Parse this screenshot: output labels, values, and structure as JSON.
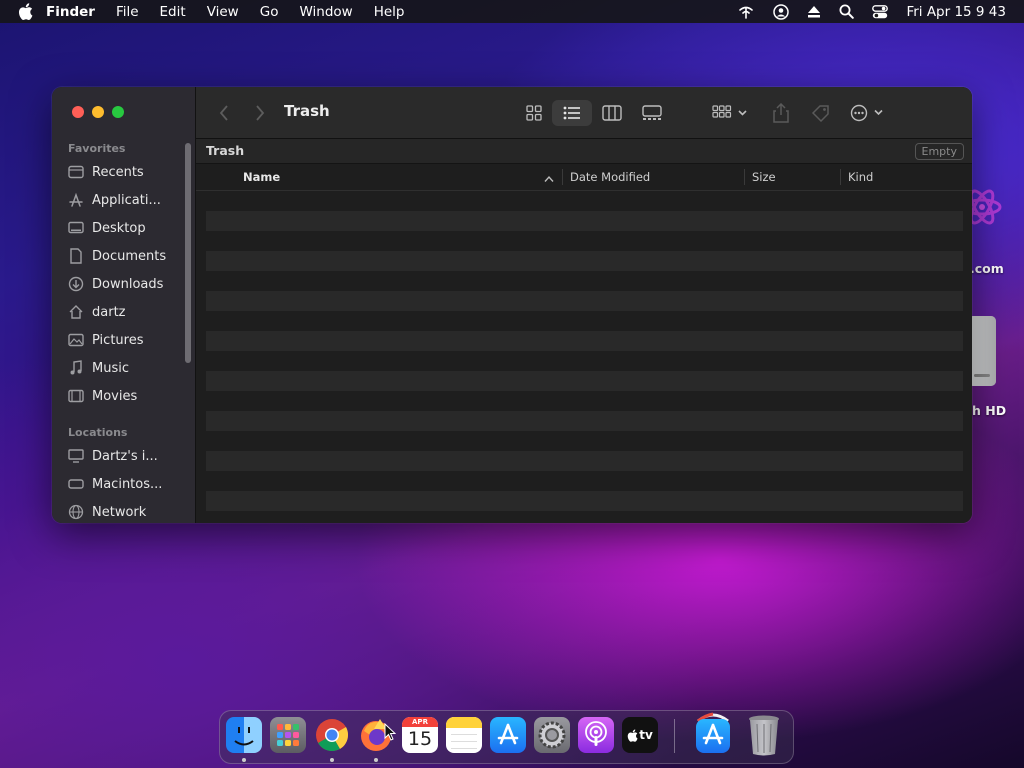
{
  "menubar": {
    "items": [
      {
        "label": "Finder",
        "bold": true
      },
      {
        "label": "File"
      },
      {
        "label": "Edit"
      },
      {
        "label": "View"
      },
      {
        "label": "Go"
      },
      {
        "label": "Window"
      },
      {
        "label": "Help"
      }
    ],
    "status_icons": [
      "wifi-icon",
      "user-icon",
      "eject-icon",
      "search-icon",
      "control-center-icon"
    ],
    "clock": "Fri Apr 15  9 43"
  },
  "desktop": {
    "items": [
      {
        "label": ".com",
        "icon": "app-icon"
      },
      {
        "label": "h HD",
        "icon": "hard-drive-icon"
      }
    ]
  },
  "window": {
    "title": "Trash",
    "sidebar": {
      "favorites_title": "Favorites",
      "favorites": [
        {
          "label": "Recents",
          "icon": "clock-icon"
        },
        {
          "label": "Applicati...",
          "icon": "applications-icon"
        },
        {
          "label": "Desktop",
          "icon": "desktop-icon"
        },
        {
          "label": "Documents",
          "icon": "document-icon"
        },
        {
          "label": "Downloads",
          "icon": "download-icon"
        },
        {
          "label": "dartz",
          "icon": "home-icon"
        },
        {
          "label": "Pictures",
          "icon": "pictures-icon"
        },
        {
          "label": "Music",
          "icon": "music-icon"
        },
        {
          "label": "Movies",
          "icon": "movies-icon"
        }
      ],
      "locations_title": "Locations",
      "locations": [
        {
          "label": "Dartz's i...",
          "icon": "computer-icon"
        },
        {
          "label": "Macintos...",
          "icon": "disk-icon"
        },
        {
          "label": "Network",
          "icon": "network-icon"
        }
      ]
    },
    "pathbar": {
      "title": "Trash",
      "empty_button": "Empty"
    },
    "columns": {
      "name": "Name",
      "date": "Date Modified",
      "size": "Size",
      "kind": "Kind"
    }
  },
  "dock": {
    "apps": [
      "finder",
      "launchpad",
      "chrome",
      "firefox",
      "calendar",
      "notes",
      "app-store",
      "system-preferences",
      "podcasts",
      "apple-tv",
      "app-store-downloads",
      "trash"
    ],
    "calendar_month": "APR",
    "calendar_day": "15",
    "tv_label": "tv"
  },
  "colors": {
    "accent": "#2a6fd6",
    "close": "#ff5f57",
    "minimize": "#febc2e",
    "zoom": "#28c840"
  }
}
